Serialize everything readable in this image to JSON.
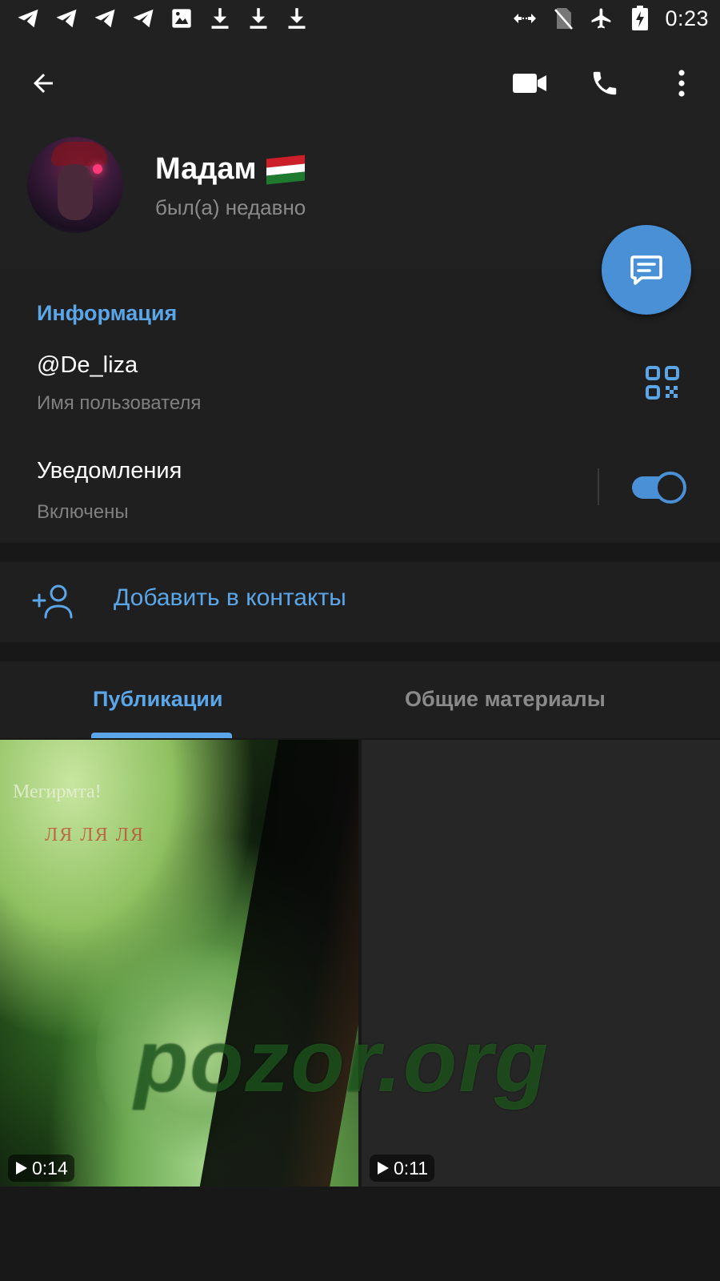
{
  "status_bar": {
    "left_icons": [
      "telegram-icon",
      "telegram-icon",
      "telegram-icon",
      "telegram-icon",
      "image-icon",
      "download-icon",
      "download-icon",
      "download-icon"
    ],
    "right_icons": [
      "data-arrows-icon",
      "no-sim-icon",
      "airplane-icon",
      "battery-charging-icon"
    ],
    "time": "0:23"
  },
  "toolbar": {
    "back": "back-arrow-icon",
    "video_call": "video-camera-icon",
    "voice_call": "phone-icon",
    "more": "more-vert-icon"
  },
  "profile": {
    "name": "Мадам",
    "status": "был(а) недавно"
  },
  "info": {
    "title": "Информация",
    "username": "@De_liza",
    "username_caption": "Имя пользователя",
    "notifications_label": "Уведомления",
    "notifications_state": "Включены",
    "notifications_enabled": true
  },
  "add_contact": {
    "label": "Добавить в контакты"
  },
  "tabs": {
    "posts": "Публикации",
    "shared": "Общие материалы",
    "active": "posts"
  },
  "media": [
    {
      "duration": "0:14",
      "caption_line1": "Мегирмта!",
      "caption_line2": "ЛЯ ЛЯ ЛЯ"
    },
    {
      "duration": "0:11"
    }
  ],
  "watermark": "pozor.org",
  "colors": {
    "accent": "#5aa6e8",
    "fab": "#4a90d6",
    "background": "#1f1f1f"
  }
}
